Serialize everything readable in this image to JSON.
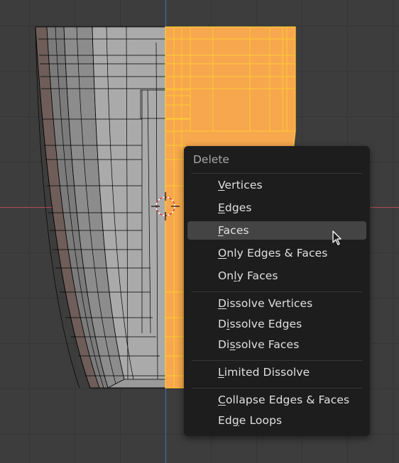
{
  "viewport": {
    "colors": {
      "background": "#3d3d3d",
      "grid_line": "#363636",
      "x_axis": "#b34a57",
      "z_axis": "#3f67b0",
      "selected_face": "#f7a74d",
      "selected_edge": "#ffcc33",
      "mesh_face": "#9d9d9d",
      "mesh_edge": "#000000"
    }
  },
  "menu": {
    "title": "Delete",
    "highlighted_index": 2,
    "items": [
      {
        "pre": "",
        "u": "V",
        "post": "ertices"
      },
      {
        "pre": "",
        "u": "E",
        "post": "dges"
      },
      {
        "pre": "",
        "u": "F",
        "post": "aces"
      },
      {
        "pre": "",
        "u": "O",
        "post": "nly Edges & Faces"
      },
      {
        "pre": "On",
        "u": "l",
        "post": "y Faces"
      },
      {
        "pre": "",
        "u": "D",
        "post": "issolve Vertices"
      },
      {
        "pre": "D",
        "u": "i",
        "post": "ssolve Edges"
      },
      {
        "pre": "Di",
        "u": "s",
        "post": "solve Faces"
      },
      {
        "pre": "",
        "u": "L",
        "post": "imited Dissolve"
      },
      {
        "pre": "",
        "u": "C",
        "post": "ollapse Edges & Faces"
      },
      {
        "pre": "Ed",
        "u": "g",
        "post": "e Loops"
      }
    ]
  }
}
